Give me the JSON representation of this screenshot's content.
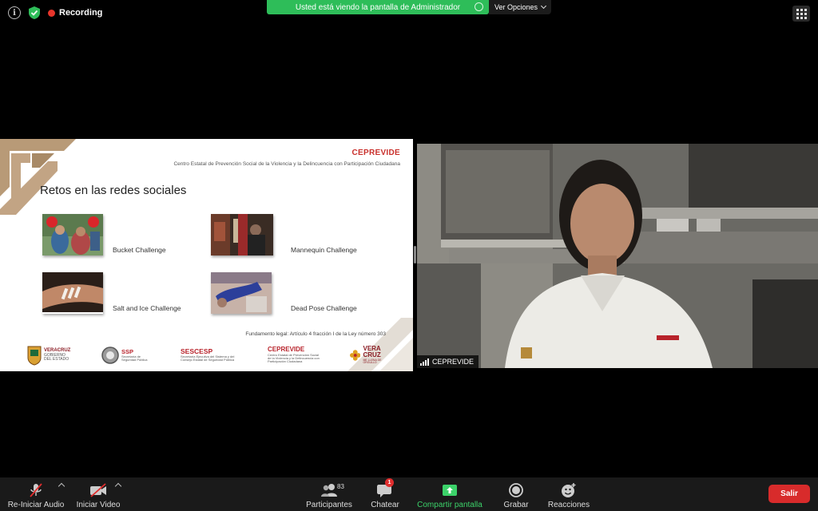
{
  "top": {
    "recording_label": "Recording",
    "share_banner": "Usted está viendo la pantalla de Administrador",
    "view_options": "Ver Opciones"
  },
  "slide": {
    "brand": "CEPREVIDE",
    "brand_subtitle": "Centro Estatal de Prevención Social de la Violencia y la Delincuencia con Participación Ciudadana",
    "title": "Retos en las redes sociales",
    "challenges": [
      {
        "label": "Bucket Challenge"
      },
      {
        "label": "Mannequin Challenge"
      },
      {
        "label": "Salt and Ice Challenge"
      },
      {
        "label": "Dead Pose Challenge"
      }
    ],
    "legal": "Fundamento legal: Artículo 4 fracción I de la Ley número 303",
    "logos": {
      "veracruz_gov": [
        "VERACRUZ",
        "GOBIERNO",
        "DEL ESTADO"
      ],
      "ssp": {
        "main": "SSP",
        "sub": [
          "Secretaría de",
          "Seguridad Pública"
        ]
      },
      "sescesp": {
        "main": "SESCESP",
        "sub": [
          "Secretaría Ejecutiva del Sistema y del",
          "Consejo Estatal de Seguridad Pública"
        ]
      },
      "ceprevide": {
        "main": "CEPREVIDE",
        "sub": [
          "Centro Estatal de Prevención Social",
          "de la Violencia y la Delincuencia con",
          "Participación Ciudadana"
        ]
      },
      "veracruz": {
        "main": [
          "VERA",
          "CRUZ"
        ],
        "sub": "ME LLENA DE ORGULLO"
      }
    }
  },
  "camera": {
    "participant_name": "CEPREVIDE"
  },
  "toolbar": {
    "audio": "Re-Iniciar Audio",
    "video": "Iniciar Video",
    "participants": "Participantes",
    "participants_count": "83",
    "chat": "Chatear",
    "chat_badge": "1",
    "share": "Compartir pantalla",
    "record": "Grabar",
    "reactions": "Reacciones",
    "exit": "Salir"
  },
  "colors": {
    "share_banner": "#2ebd59",
    "brand_red": "#c9302c",
    "exit_button": "#d82b2b",
    "share_icon_green": "#3cd26a"
  }
}
